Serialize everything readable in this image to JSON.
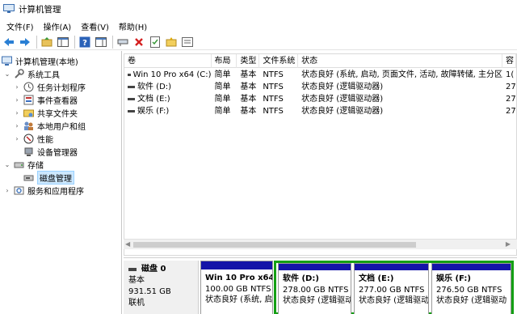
{
  "window": {
    "title": "计算机管理"
  },
  "menu": [
    "文件(F)",
    "操作(A)",
    "查看(V)",
    "帮助(H)"
  ],
  "toolbar": {
    "buttons": [
      "back-arrow-icon",
      "forward-arrow-icon",
      "up-folder-icon",
      "console-tree-icon",
      "help-icon",
      "show-pane-icon",
      "connect-icon",
      "delete-icon",
      "properties-icon",
      "new-folder-icon",
      "export-icon"
    ]
  },
  "tree": {
    "root": "计算机管理(本地)",
    "system_tools": "系统工具",
    "task_scheduler": "任务计划程序",
    "event_viewer": "事件查看器",
    "shared_folders": "共享文件夹",
    "local_users": "本地用户和组",
    "performance": "性能",
    "device_manager": "设备管理器",
    "storage": "存储",
    "disk_management": "磁盘管理",
    "services_apps": "服务和应用程序"
  },
  "volumes": {
    "columns": [
      "卷",
      "布局",
      "类型",
      "文件系统",
      "状态",
      "容"
    ],
    "rows": [
      {
        "name": "Win 10 Pro x64 (C:)",
        "layout": "简单",
        "type": "基本",
        "fs": "NTFS",
        "status": "状态良好 (系统, 启动, 页面文件, 活动, 故障转储, 主分区)",
        "cap": "1("
      },
      {
        "name": "软件 (D:)",
        "layout": "简单",
        "type": "基本",
        "fs": "NTFS",
        "status": "状态良好 (逻辑驱动器)",
        "cap": "27"
      },
      {
        "name": "文档 (E:)",
        "layout": "简单",
        "type": "基本",
        "fs": "NTFS",
        "status": "状态良好 (逻辑驱动器)",
        "cap": "27"
      },
      {
        "name": "娱乐 (F:)",
        "layout": "简单",
        "type": "基本",
        "fs": "NTFS",
        "status": "状态良好 (逻辑驱动器)",
        "cap": "27"
      }
    ]
  },
  "disk": {
    "name": "磁盘 0",
    "type": "基本",
    "size": "931.51 GB",
    "status": "联机",
    "partitions": [
      {
        "name": "Win 10 Pro x64",
        "size": "100.00 GB NTFS",
        "status": "状态良好 (系统, 启"
      },
      {
        "name": "软件  (D:)",
        "size": "278.00 GB NTFS",
        "status": "状态良好 (逻辑驱动"
      },
      {
        "name": "文档  (E:)",
        "size": "277.00 GB NTFS",
        "status": "状态良好 (逻辑驱动"
      },
      {
        "name": "娱乐  (F:)",
        "size": "276.50 GB NTFS",
        "status": "状态良好 (逻辑驱动"
      }
    ]
  },
  "colors": {
    "primary_partition": "#1414a8",
    "selection": "#14a014",
    "tree_selected": "#cce8ff"
  }
}
